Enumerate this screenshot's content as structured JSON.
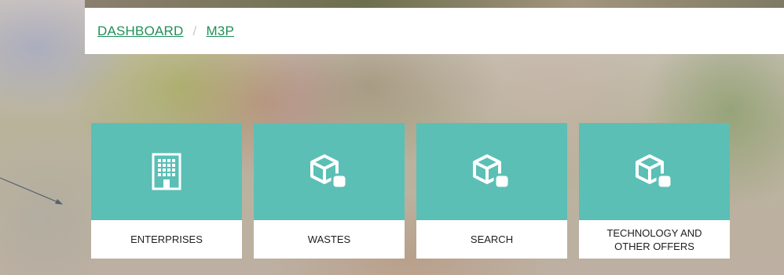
{
  "breadcrumb": {
    "items": [
      "DASHBOARD",
      "M3P"
    ],
    "separator": "/"
  },
  "tiles": [
    {
      "label": "ENTERPRISES",
      "icon": "building-icon"
    },
    {
      "label": "WASTES",
      "icon": "cube-icon"
    },
    {
      "label": "SEARCH",
      "icon": "cube-icon"
    },
    {
      "label": "TECHNOLOGY AND OTHER OFFERS",
      "icon": "cube-icon"
    }
  ],
  "colors": {
    "tile_accent": "#5bbfb6",
    "link": "#1f8f57"
  }
}
